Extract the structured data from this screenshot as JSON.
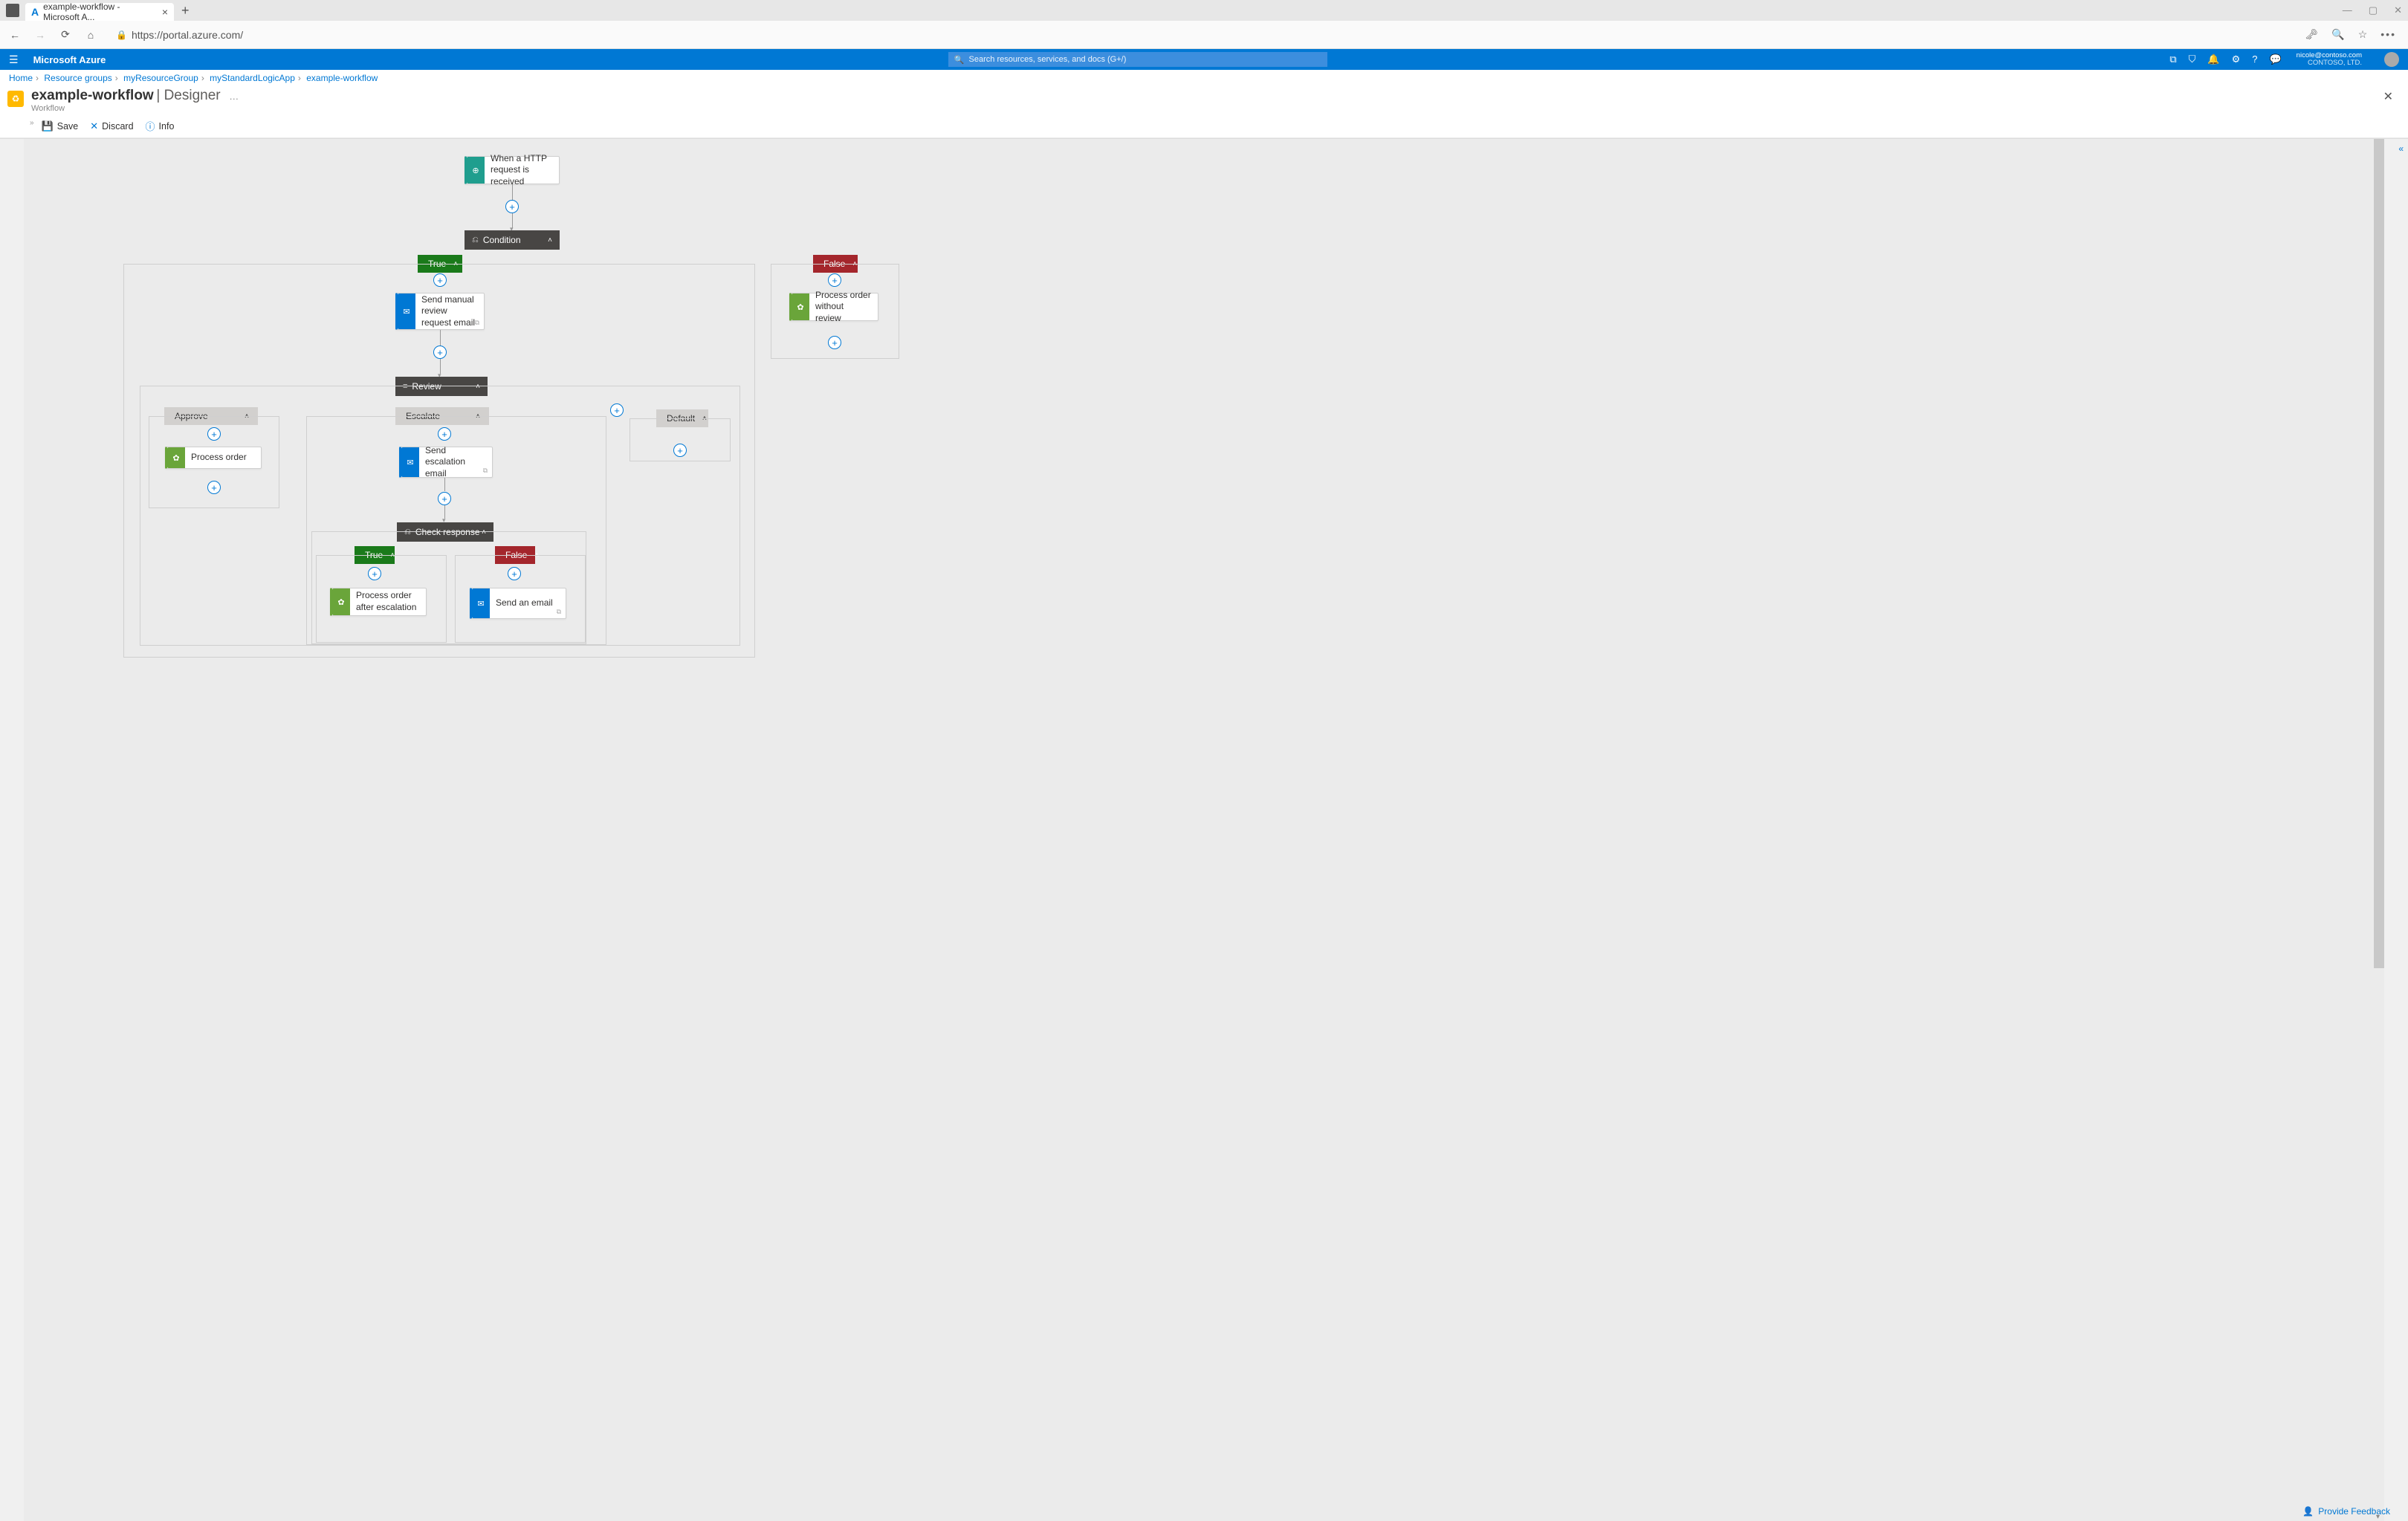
{
  "browser": {
    "tab_title": "example-workflow - Microsoft A...",
    "url": "https://portal.azure.com/",
    "url_display_prefix": "https://"
  },
  "azure": {
    "brand": "Microsoft Azure",
    "search_placeholder": "Search resources, services, and docs (G+/)",
    "user_email": "nicole@contoso.com",
    "user_org": "CONTOSO, LTD."
  },
  "breadcrumb": [
    "Home",
    "Resource groups",
    "myResourceGroup",
    "myStandardLogicApp",
    "example-workflow"
  ],
  "page": {
    "title": "example-workflow",
    "mode": "Designer",
    "subtitle": "Workflow"
  },
  "toolbar": {
    "save": "Save",
    "discard": "Discard",
    "info": "Info"
  },
  "nodes": {
    "http_trigger": "When a HTTP request is received",
    "condition": "Condition",
    "true": "True",
    "false": "False",
    "send_review": "Send manual review request email",
    "process_no_review": "Process order without review",
    "review": "Review",
    "approve": "Approve",
    "escalate": "Escalate",
    "default": "Default",
    "process_order": "Process order",
    "send_escalation": "Send escalation email",
    "check_response": "Check response",
    "process_after_escalation": "Process order after escalation",
    "send_an_email": "Send an email"
  },
  "footer": {
    "feedback": "Provide Feedback"
  }
}
